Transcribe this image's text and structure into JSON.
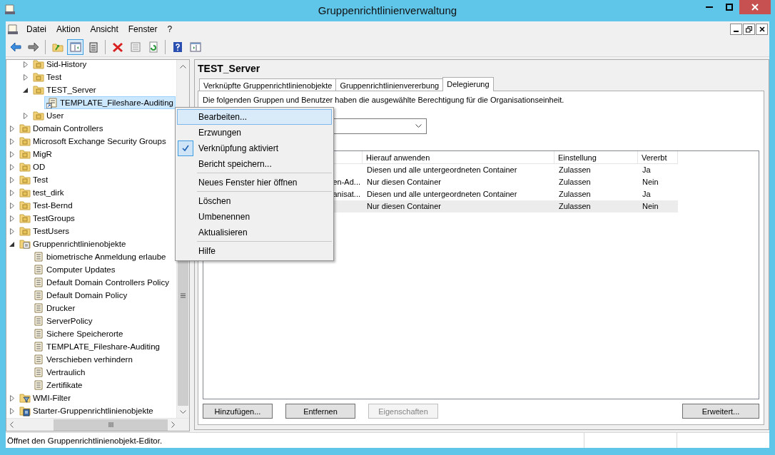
{
  "window": {
    "title": "Gruppenrichtlinienverwaltung"
  },
  "menu": [
    "Datei",
    "Aktion",
    "Ansicht",
    "Fenster",
    "?"
  ],
  "toolbar": [
    {
      "kind": "back",
      "pressed": false
    },
    {
      "kind": "forward",
      "pressed": false
    },
    {
      "kind": "up",
      "pressed": false
    },
    {
      "kind": "tree",
      "pressed": true
    },
    {
      "kind": "clipboard",
      "pressed": false
    },
    {
      "kind": "delete",
      "pressed": false
    },
    {
      "kind": "properties",
      "pressed": false
    },
    {
      "kind": "refresh",
      "pressed": false
    },
    {
      "kind": "help",
      "pressed": false
    },
    {
      "kind": "window",
      "pressed": false
    }
  ],
  "tree": [
    {
      "children": [
        {
          "label": "Sid-History",
          "kind": "ou",
          "expanded": false,
          "selected": false
        },
        {
          "label": "Test",
          "kind": "ou",
          "expanded": false,
          "selected": false
        },
        {
          "label": "TEST_Server",
          "kind": "ou",
          "expanded": true,
          "selected": false,
          "children": [
            {
              "label": "TEMPLATE_Fileshare-Auditing",
              "kind": "gpo_link",
              "selected": true
            }
          ]
        },
        {
          "label": "User",
          "kind": "ou",
          "expanded": false,
          "selected": false
        }
      ]
    },
    {
      "label": "Domain Controllers",
      "kind": "ou",
      "expanded": false,
      "selected": false
    },
    {
      "label": "Microsoft Exchange Security Groups",
      "kind": "ou",
      "expanded": false,
      "selected": false
    },
    {
      "label": "MigR",
      "kind": "ou",
      "expanded": false,
      "selected": false
    },
    {
      "label": "OD",
      "kind": "ou",
      "expanded": false,
      "selected": false
    },
    {
      "label": "Test",
      "kind": "ou",
      "expanded": false,
      "selected": false
    },
    {
      "label": "test_dirk",
      "kind": "ou",
      "expanded": false,
      "selected": false
    },
    {
      "label": "Test-Bernd",
      "kind": "ou",
      "expanded": false,
      "selected": false
    },
    {
      "label": "TestGroups",
      "kind": "ou",
      "expanded": false,
      "selected": false
    },
    {
      "label": "TestUsers",
      "kind": "ou",
      "expanded": false,
      "selected": false
    },
    {
      "label": "Gruppenrichtlinienobjekte",
      "kind": "gpo_container",
      "expanded": true,
      "selected": false,
      "children": [
        {
          "label": "biometrische Anmeldung erlaube",
          "kind": "gpo",
          "selected": false
        },
        {
          "label": "Computer Updates",
          "kind": "gpo",
          "selected": false
        },
        {
          "label": "Default Domain Controllers Policy",
          "kind": "gpo",
          "selected": false
        },
        {
          "label": "Default Domain Policy",
          "kind": "gpo",
          "selected": false
        },
        {
          "label": "Drucker",
          "kind": "gpo",
          "selected": false
        },
        {
          "label": "ServerPolicy",
          "kind": "gpo",
          "selected": false
        },
        {
          "label": "Sichere Speicherorte",
          "kind": "gpo",
          "selected": false
        },
        {
          "label": "TEMPLATE_Fileshare-Auditing",
          "kind": "gpo",
          "selected": false
        },
        {
          "label": "Verschieben verhindern",
          "kind": "gpo",
          "selected": false
        },
        {
          "label": "Vertraulich",
          "kind": "gpo",
          "selected": false
        },
        {
          "label": "Zertifikate",
          "kind": "gpo",
          "selected": false
        }
      ]
    },
    {
      "label": "WMI-Filter",
      "kind": "wmi",
      "expanded": false,
      "selected": false
    },
    {
      "label": "Starter-Gruppenrichtlinienobjekte",
      "kind": "starter",
      "expanded": false,
      "selected": false
    }
  ],
  "details": {
    "title": "TEST_Server",
    "tabs": [
      {
        "label": "Verknüpfte Gruppenrichtlinienobjekte",
        "selected": false
      },
      {
        "label": "Gruppenrichtlinienvererbung",
        "selected": false
      },
      {
        "label": "Delegierung",
        "selected": true
      }
    ],
    "description": "Die folgenden Gruppen und Benutzer haben die ausgewählte Berechtigung für die Organisationseinheit.",
    "table": {
      "columns": [
        "Hierauf anwenden",
        "Einstellung",
        "Vererbt"
      ],
      "rows": [
        {
          "cells": [
            "Diesen und alle untergeordneten Container",
            "Zulassen",
            "Ja"
          ],
          "selected": false
        },
        {
          "column_1": "en-Ad...",
          "cells": [
            "Nur diesen Container",
            "Zulassen",
            "Nein"
          ],
          "selected": false
        },
        {
          "column_1": "anisat...",
          "cells": [
            "Diesen und alle untergeordneten Container",
            "Zulassen",
            "Ja"
          ],
          "selected": false
        },
        {
          "cells": [
            "Nur diesen Container",
            "Zulassen",
            "Nein"
          ],
          "selected": true
        }
      ]
    },
    "buttons": [
      {
        "label": "Hinzufügen...",
        "disabled": false
      },
      {
        "label": "Entfernen",
        "disabled": false
      },
      {
        "label": "Eigenschaften",
        "disabled": true
      },
      {
        "label": "Erweitert...",
        "disabled": false
      }
    ]
  },
  "context_menu": [
    {
      "kind": "item",
      "label": "Bearbeiten...",
      "highlighted": true,
      "checked": false
    },
    {
      "kind": "item",
      "label": "Erzwungen",
      "highlighted": false,
      "checked": false
    },
    {
      "kind": "item",
      "label": "Verknüpfung aktiviert",
      "highlighted": false,
      "checked": true
    },
    {
      "kind": "item",
      "label": "Bericht speichern...",
      "highlighted": false,
      "checked": false
    },
    {
      "kind": "separator"
    },
    {
      "kind": "item",
      "label": "Neues Fenster hier öffnen",
      "highlighted": false,
      "checked": false
    },
    {
      "kind": "separator"
    },
    {
      "kind": "item",
      "label": "Löschen",
      "highlighted": false,
      "checked": false
    },
    {
      "kind": "item",
      "label": "Umbenennen",
      "highlighted": false,
      "checked": false
    },
    {
      "kind": "item",
      "label": "Aktualisieren",
      "highlighted": false,
      "checked": false
    },
    {
      "kind": "separator"
    },
    {
      "kind": "item",
      "label": "Hilfe",
      "highlighted": false,
      "checked": false
    }
  ],
  "status_bar": "Öffnet den Gruppenrichtlinienobjekt-Editor."
}
